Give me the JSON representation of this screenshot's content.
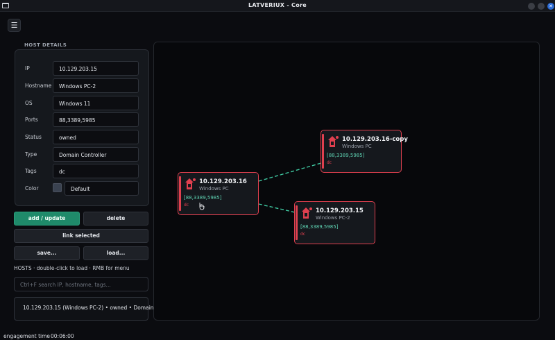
{
  "window": {
    "title": "LATVERIUX - Core"
  },
  "details": {
    "section_title": "HOST DETAILS",
    "fields": [
      {
        "label": "IP",
        "value": "10.129.203.15"
      },
      {
        "label": "Hostname",
        "value": "Windows PC-2"
      },
      {
        "label": "OS",
        "value": "Windows 11"
      },
      {
        "label": "Ports",
        "value": "88,3389,5985"
      },
      {
        "label": "Status",
        "value": "owned"
      },
      {
        "label": "Type",
        "value": "Domain Controller"
      },
      {
        "label": "Tags",
        "value": "dc"
      }
    ],
    "color": {
      "label": "Color",
      "value": "Default",
      "swatch": "#3a4250"
    }
  },
  "buttons": {
    "add_update": "add / update",
    "delete": "delete",
    "link_selected": "link selected",
    "save": "save...",
    "load": "load..."
  },
  "hosts": {
    "hint": "HOSTS  ·  double-click to load  ·  RMB for menu",
    "search_placeholder": "Ctrl+F  search IP, hostname, tags...",
    "items": [
      {
        "text": "10.129.203.15  (Windows PC-2)  • owned • Domain"
      }
    ]
  },
  "graph": {
    "nodes": [
      {
        "ip": "10.129.203.16",
        "os": "Windows PC",
        "ports": "[88,3389,5985]",
        "tag": "dc"
      },
      {
        "ip": "10.129.203.16-copy",
        "os": "Windows PC",
        "ports": "[88,3389,5985]",
        "tag": "dc"
      },
      {
        "ip": "10.129.203.15",
        "os": "Windows PC-2",
        "ports": "[88,3389,5985]",
        "tag": "dc"
      }
    ],
    "edge_color": "#3fc7a0",
    "node_accent": "#e0404f"
  },
  "status": {
    "label": "engagement time",
    "value": "00:06:00"
  },
  "colors": {
    "accent": "#1f8a6a",
    "danger": "#e0404f",
    "bg": "#0b0c10"
  }
}
